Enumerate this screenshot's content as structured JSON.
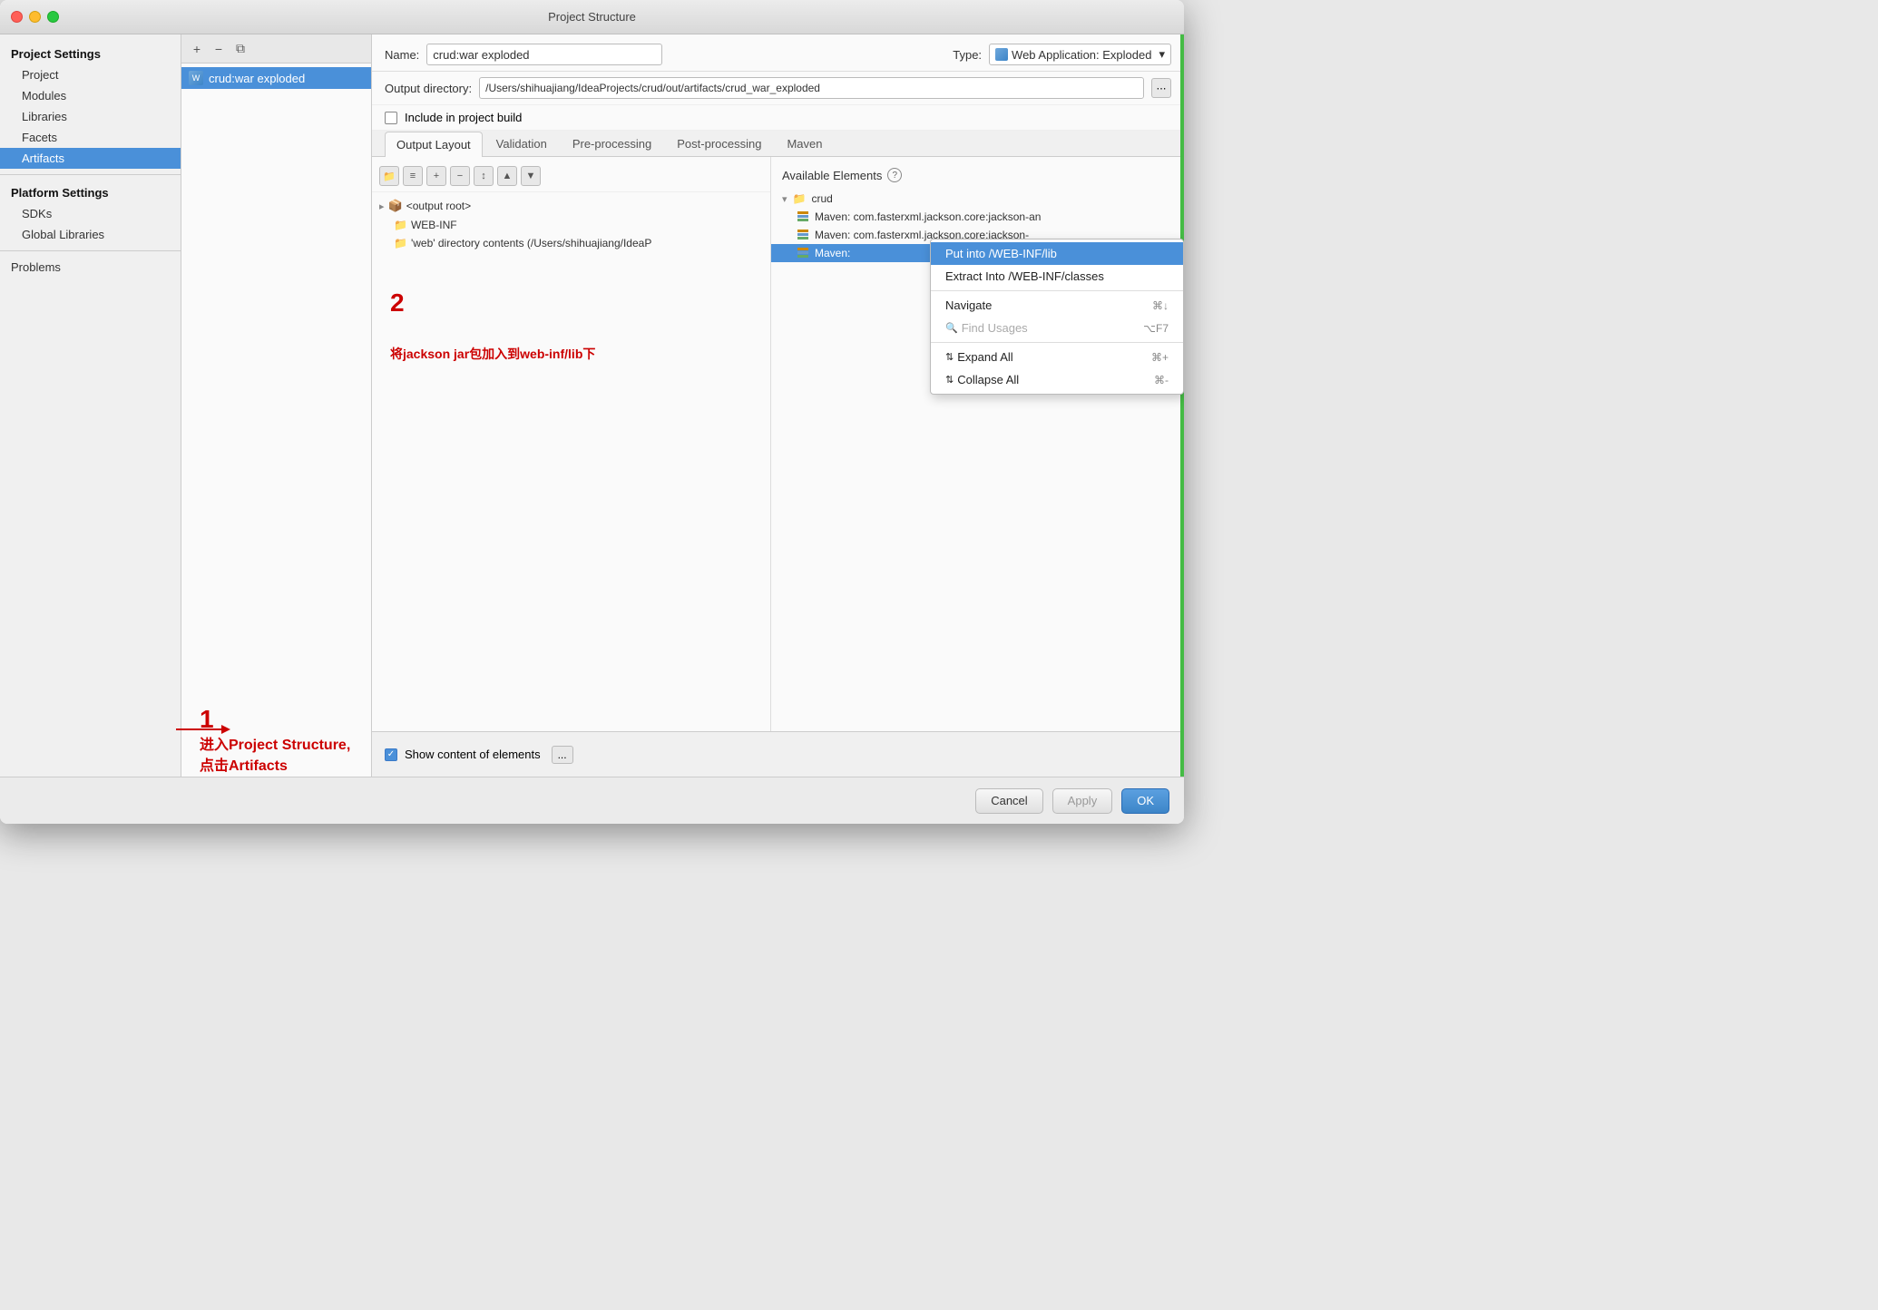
{
  "window": {
    "title": "Project Structure"
  },
  "sidebar": {
    "project_settings_header": "Project Settings",
    "items": [
      {
        "label": "Project",
        "id": "project"
      },
      {
        "label": "Modules",
        "id": "modules"
      },
      {
        "label": "Libraries",
        "id": "libraries"
      },
      {
        "label": "Facets",
        "id": "facets"
      },
      {
        "label": "Artifacts",
        "id": "artifacts"
      }
    ],
    "platform_settings_header": "Platform Settings",
    "platform_items": [
      {
        "label": "SDKs",
        "id": "sdks"
      },
      {
        "label": "Global Libraries",
        "id": "global-libraries"
      }
    ],
    "problems_label": "Problems"
  },
  "artifact_panel": {
    "item": "crud:war exploded"
  },
  "fields": {
    "name_label": "Name:",
    "name_value": "crud:war exploded",
    "type_label": "Type:",
    "type_value": "Web Application: Exploded",
    "output_dir_label": "Output directory:",
    "output_dir_value": "/Users/shihuajiang/IdeaProjects/crud/out/artifacts/crud_war_exploded",
    "include_build_label": "Include in project build"
  },
  "tabs": [
    {
      "label": "Output Layout",
      "active": true
    },
    {
      "label": "Validation",
      "active": false
    },
    {
      "label": "Pre-processing",
      "active": false
    },
    {
      "label": "Post-processing",
      "active": false
    },
    {
      "label": "Maven",
      "active": false
    }
  ],
  "output_tree": {
    "items": [
      {
        "label": "<output root>",
        "type": "root",
        "indent": 0
      },
      {
        "label": "WEB-INF",
        "type": "folder",
        "indent": 1
      },
      {
        "label": "'web' directory contents (/Users/shihuajiang/IdeaP",
        "type": "folder",
        "indent": 1
      }
    ]
  },
  "available_elements": {
    "header": "Available Elements",
    "items": [
      {
        "label": "crud",
        "type": "group"
      },
      {
        "label": "Maven: com.fasterxml.jackson.core:jackson-an",
        "type": "maven"
      },
      {
        "label": "Maven: com.fasterxml.jackson.core:jackson-",
        "type": "maven"
      },
      {
        "label": "Maven:",
        "type": "maven"
      }
    ]
  },
  "context_menu": {
    "items": [
      {
        "label": "Put into /WEB-INF/lib",
        "highlighted": true,
        "shortcut": ""
      },
      {
        "label": "Extract Into /WEB-INF/classes",
        "highlighted": false,
        "shortcut": ""
      },
      {
        "label": "",
        "type": "separator"
      },
      {
        "label": "Navigate",
        "disabled": false,
        "shortcut": "⌘↓"
      },
      {
        "label": "Find Usages",
        "disabled": true,
        "shortcut": "⌥F7"
      },
      {
        "label": "",
        "type": "separator"
      },
      {
        "label": "Expand All",
        "disabled": false,
        "shortcut": "⌘+"
      },
      {
        "label": "Collapse All",
        "disabled": false,
        "shortcut": "⌘-"
      }
    ]
  },
  "bottom_bar": {
    "show_content_label": "Show content of elements",
    "dots_btn": "..."
  },
  "footer": {
    "cancel_label": "Cancel",
    "apply_label": "Apply",
    "ok_label": "OK"
  },
  "annotation": {
    "number1": "1",
    "text1": "进入Project Structure,点击Artifacts",
    "number2": "2",
    "text2": "将jackson jar包加入到web-inf/lib下"
  }
}
